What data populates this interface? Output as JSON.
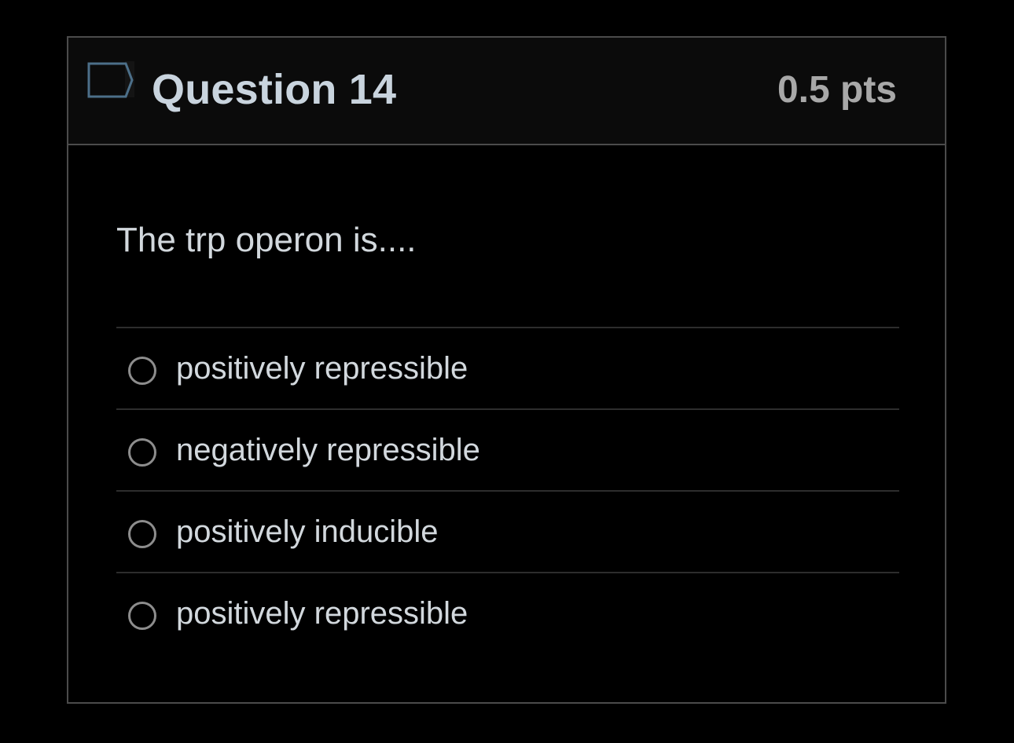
{
  "question": {
    "flag_icon": "flag-outline-icon",
    "title": "Question 14",
    "points": "0.5 pts",
    "prompt": "The trp operon is....",
    "answers": [
      {
        "label": "positively repressible",
        "selected": false
      },
      {
        "label": "negatively repressible",
        "selected": false
      },
      {
        "label": "positively inducible",
        "selected": false
      },
      {
        "label": "positively repressible",
        "selected": false
      }
    ]
  },
  "colors": {
    "background": "#000000",
    "header_background": "#0b0b0b",
    "border": "#4b4b4b",
    "title_text": "#c9d4de",
    "points_text": "#a8a8a8",
    "body_text": "#d2d8dd",
    "flag_outline": "#4c6f89"
  }
}
